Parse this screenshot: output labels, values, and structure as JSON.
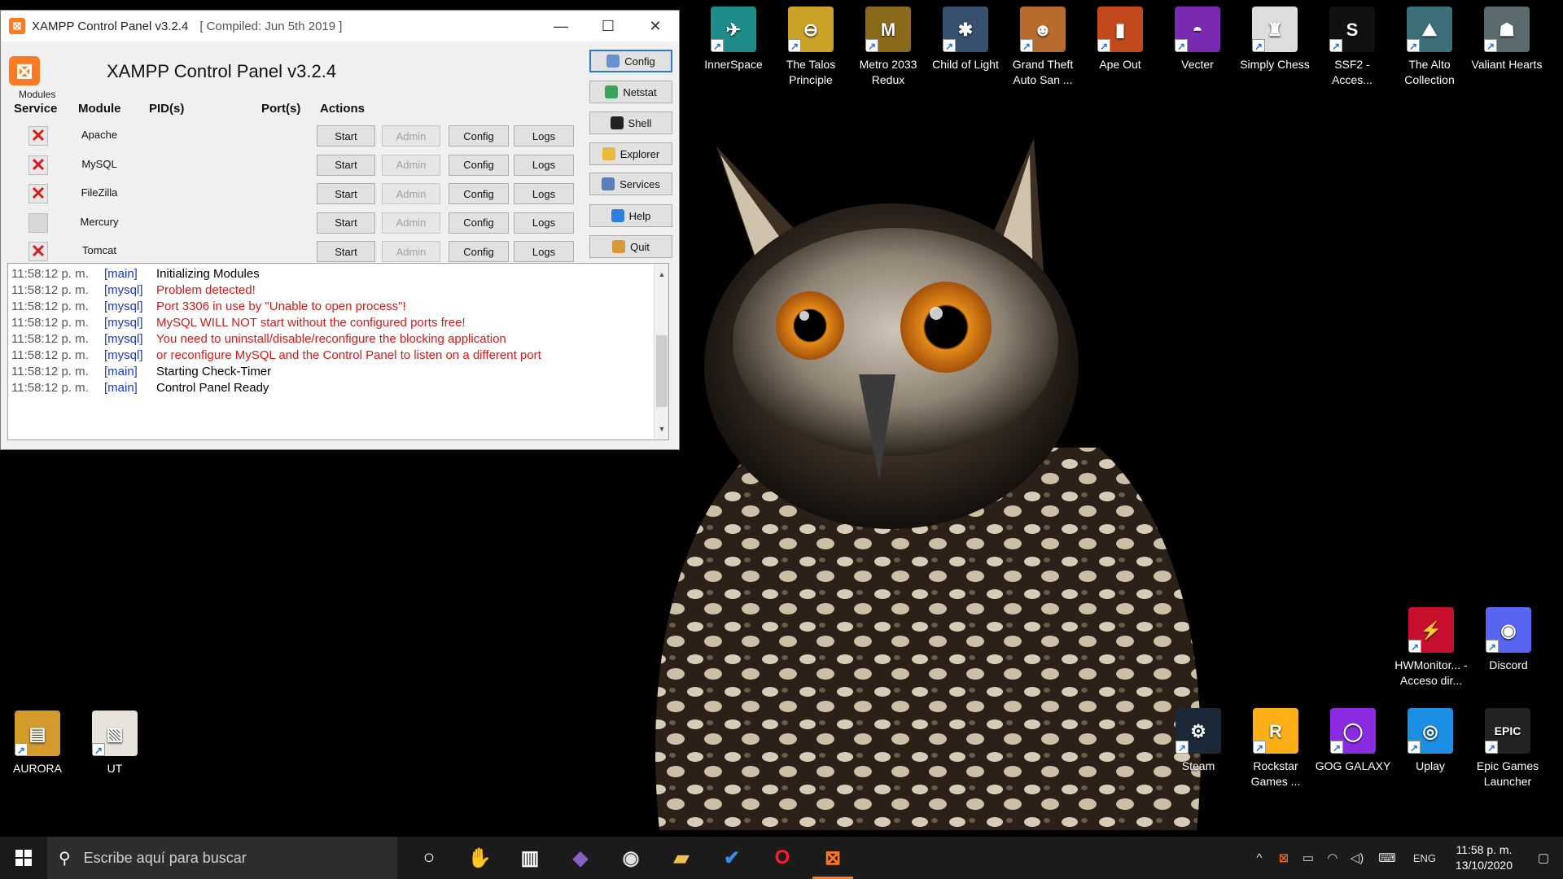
{
  "window": {
    "title": "XAMPP Control Panel v3.2.4",
    "compiled": "[ Compiled: Jun 5th 2019 ]",
    "heading": "XAMPP Control Panel v3.2.4",
    "modules_label": "Modules",
    "columns": {
      "service": "Service",
      "module": "Module",
      "pids": "PID(s)",
      "ports": "Port(s)",
      "actions": "Actions"
    },
    "modules": [
      {
        "name": "Apache",
        "service": "x",
        "start": "Start",
        "admin": "Admin",
        "config": "Config",
        "logs": "Logs"
      },
      {
        "name": "MySQL",
        "service": "x",
        "start": "Start",
        "admin": "Admin",
        "config": "Config",
        "logs": "Logs"
      },
      {
        "name": "FileZilla",
        "service": "x",
        "start": "Start",
        "admin": "Admin",
        "config": "Config",
        "logs": "Logs"
      },
      {
        "name": "Mercury",
        "service": "",
        "start": "Start",
        "admin": "Admin",
        "config": "Config",
        "logs": "Logs"
      },
      {
        "name": "Tomcat",
        "service": "x",
        "start": "Start",
        "admin": "Admin",
        "config": "Config",
        "logs": "Logs"
      }
    ],
    "side_buttons": [
      {
        "label": "Config",
        "icon": "wrench-icon",
        "color": "#6a8fd0"
      },
      {
        "label": "Netstat",
        "icon": "globe-icon",
        "color": "#3aa55a"
      },
      {
        "label": "Shell",
        "icon": "terminal-icon",
        "color": "#222222"
      },
      {
        "label": "Explorer",
        "icon": "folder-icon",
        "color": "#e8b93a"
      },
      {
        "label": "Services",
        "icon": "services-icon",
        "color": "#5a7fb8"
      },
      {
        "label": "Help",
        "icon": "help-icon",
        "color": "#2f7fe0"
      },
      {
        "label": "Quit",
        "icon": "quit-icon",
        "color": "#d89a36"
      }
    ],
    "log": [
      {
        "time": "11:58:12 p. m.",
        "source": "[main]",
        "message": "Initializing Modules",
        "level": "normal"
      },
      {
        "time": "11:58:12 p. m.",
        "source": "[mysql]",
        "message": "Problem detected!",
        "level": "error"
      },
      {
        "time": "11:58:12 p. m.",
        "source": "[mysql]",
        "message": "Port 3306 in use by \"Unable to open process\"!",
        "level": "error"
      },
      {
        "time": "11:58:12 p. m.",
        "source": "[mysql]",
        "message": "MySQL WILL NOT start without the configured ports free!",
        "level": "error"
      },
      {
        "time": "11:58:12 p. m.",
        "source": "[mysql]",
        "message": "You need to uninstall/disable/reconfigure the blocking application",
        "level": "error"
      },
      {
        "time": "11:58:12 p. m.",
        "source": "[mysql]",
        "message": "or reconfigure MySQL and the Control Panel to listen on a different port",
        "level": "error"
      },
      {
        "time": "11:58:12 p. m.",
        "source": "[main]",
        "message": "Starting Check-Timer",
        "level": "normal"
      },
      {
        "time": "11:58:12 p. m.",
        "source": "[main]",
        "message": "Control Panel Ready",
        "level": "normal"
      }
    ]
  },
  "desktop_icons_top": [
    {
      "label": "InnerSpace",
      "color": "#1e8c8a",
      "glyph": "✈"
    },
    {
      "label": "The Talos Principle",
      "color": "#c9a227",
      "glyph": "⊖"
    },
    {
      "label": "Metro 2033 Redux",
      "color": "#8a6a1a",
      "glyph": "M"
    },
    {
      "label": "Child of Light",
      "color": "#36506e",
      "glyph": "✱"
    },
    {
      "label": "Grand Theft Auto San ...",
      "color": "#b76b2c",
      "glyph": "☻"
    },
    {
      "label": "Ape Out",
      "color": "#c2491c",
      "glyph": "▮"
    },
    {
      "label": "Vecter",
      "color": "#7a2ab0",
      "glyph": "◓"
    },
    {
      "label": "Simply Chess",
      "color": "#dddddd",
      "glyph": "♜"
    },
    {
      "label": "SSF2 - Acces...",
      "color": "#111111",
      "glyph": "S"
    },
    {
      "label": "The Alto Collection",
      "color": "#3c6f7a",
      "glyph": "⛰"
    },
    {
      "label": "Valiant Hearts",
      "color": "#5a6a6e",
      "glyph": "☗"
    }
  ],
  "desktop_icons_bottom_left": [
    {
      "label": "AURORA",
      "color": "#d39a2c",
      "glyph": "▤"
    },
    {
      "label": "UT",
      "color": "#e8e4dc",
      "glyph": "▧"
    }
  ],
  "desktop_icons_right_mid": [
    {
      "label": "HWMonitor... - Acceso dir...",
      "color": "#c8102e",
      "glyph": "⚡"
    },
    {
      "label": "Discord",
      "color": "#5865f2",
      "glyph": "◉"
    }
  ],
  "desktop_icons_bottom_right": [
    {
      "label": "Steam",
      "color": "#1b2838",
      "glyph": "⚙"
    },
    {
      "label": "Rockstar Games ...",
      "color": "#fcaf17",
      "glyph": "R"
    },
    {
      "label": "GOG GALAXY",
      "color": "#8a2be2",
      "glyph": "◯"
    },
    {
      "label": "Uplay",
      "color": "#1a8fe3",
      "glyph": "◎"
    },
    {
      "label": "Epic Games Launcher",
      "color": "#222222",
      "glyph": "EPIC"
    }
  ],
  "taskbar": {
    "search_placeholder": "Escribe aquí para buscar",
    "apps": [
      {
        "name": "cortana-icon",
        "glyph": "○",
        "color": "#ffffff"
      },
      {
        "name": "app-icon",
        "glyph": "✋",
        "color": "#e0d2a0"
      },
      {
        "name": "library-icon",
        "glyph": "▥",
        "color": "#ffffff"
      },
      {
        "name": "visual-studio-icon",
        "glyph": "◆",
        "color": "#8661c5"
      },
      {
        "name": "media-player-icon",
        "glyph": "◉",
        "color": "#e0e0e0"
      },
      {
        "name": "file-explorer-icon",
        "glyph": "▰",
        "color": "#f2c14e"
      },
      {
        "name": "todo-icon",
        "glyph": "✔",
        "color": "#3a8de0"
      },
      {
        "name": "opera-icon",
        "glyph": "O",
        "color": "#ff1b2d"
      },
      {
        "name": "xampp-icon",
        "glyph": "⊠",
        "color": "#fb7a24"
      }
    ],
    "language": "ENG",
    "time": "11:58 p. m.",
    "date": "13/10/2020"
  }
}
